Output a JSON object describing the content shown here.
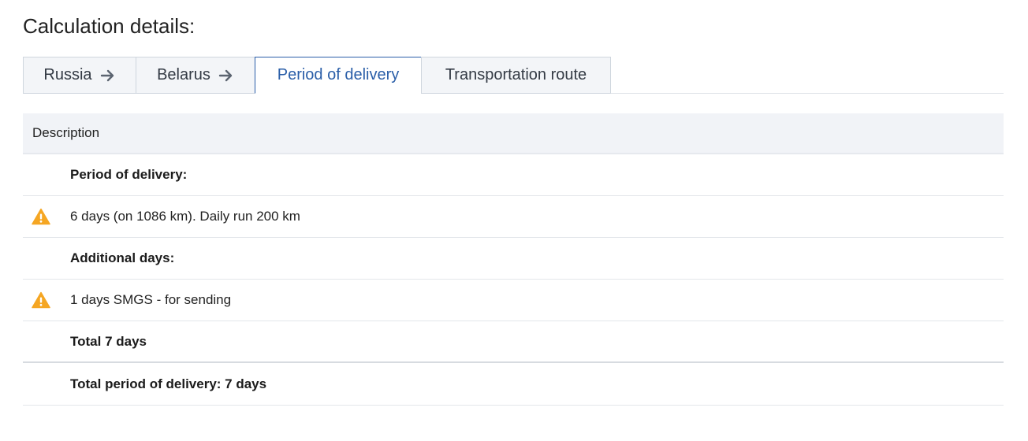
{
  "page": {
    "title": "Calculation details:"
  },
  "tabs": [
    {
      "label": "Russia",
      "has_arrow": true,
      "active": false
    },
    {
      "label": "Belarus",
      "has_arrow": true,
      "active": false
    },
    {
      "label": "Period of delivery",
      "has_arrow": false,
      "active": true
    },
    {
      "label": "Transportation route",
      "has_arrow": false,
      "active": false
    }
  ],
  "table": {
    "header": "Description",
    "rows": [
      {
        "icon": "",
        "text": "Period of delivery:",
        "bold": true
      },
      {
        "icon": "warning-icon",
        "text": "6 days (on 1086 km). Daily run 200 km",
        "bold": false
      },
      {
        "icon": "",
        "text": "Additional days:",
        "bold": true
      },
      {
        "icon": "warning-icon",
        "text": "1 days SMGS - for sending",
        "bold": false
      },
      {
        "icon": "",
        "text": "Total 7 days",
        "bold": true
      },
      {
        "icon": "",
        "text": "Total period of delivery: 7 days",
        "bold": true
      }
    ]
  },
  "colors": {
    "accent": "#2a5ea8",
    "warning": "#f5a623",
    "header_bg": "#f1f3f7",
    "tab_bg": "#f3f5f8"
  }
}
